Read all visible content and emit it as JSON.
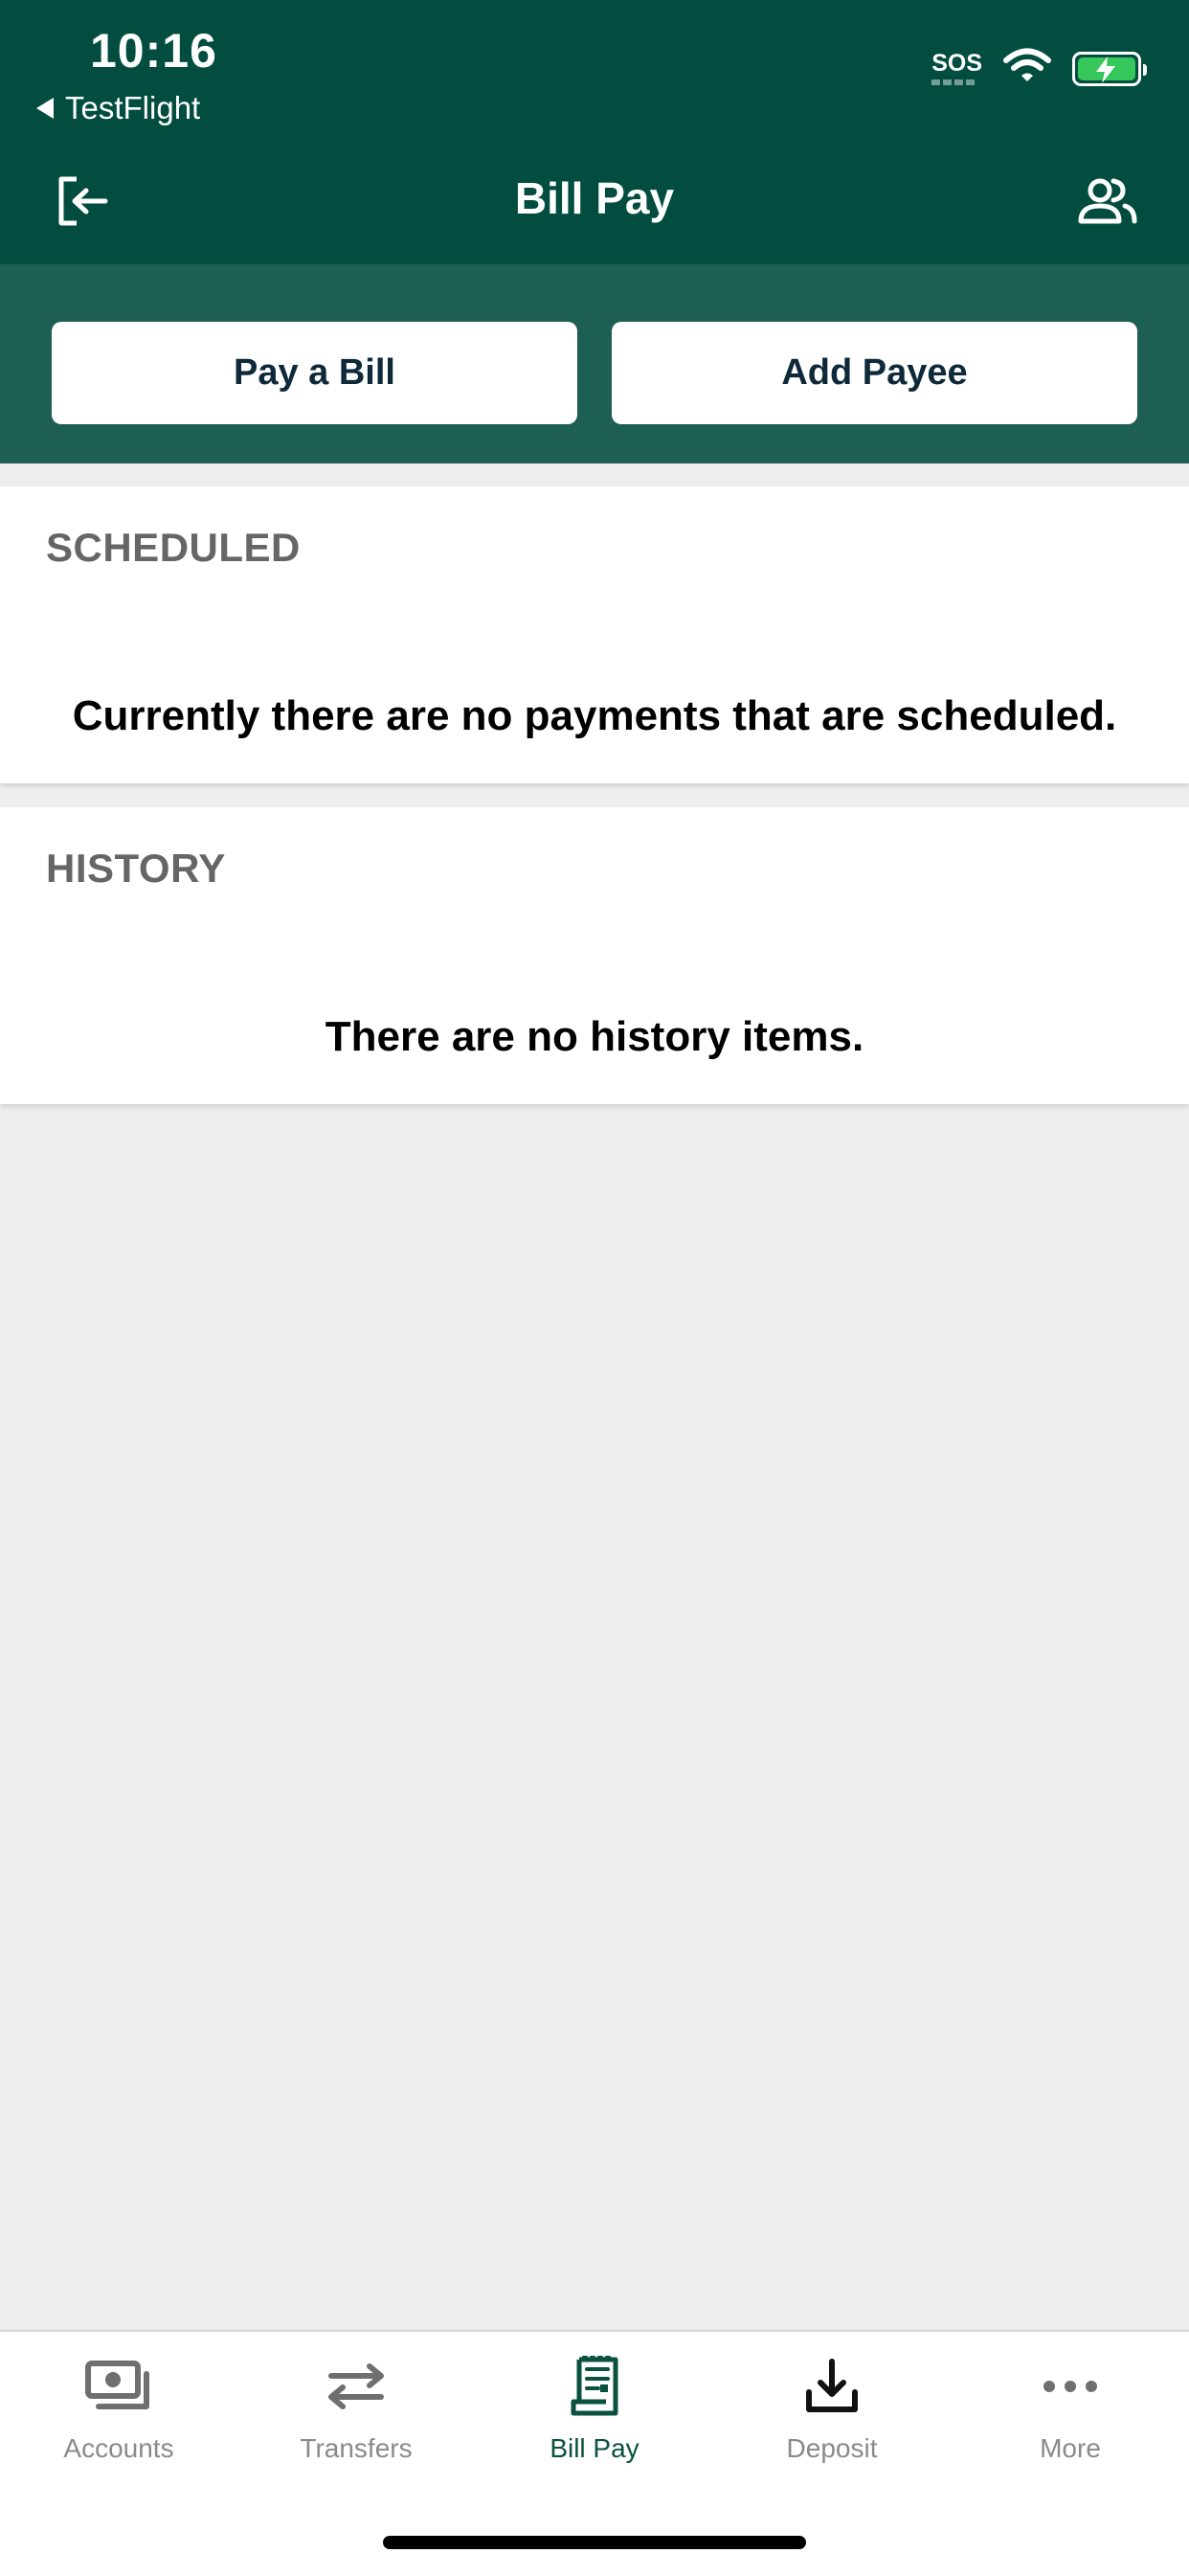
{
  "status_bar": {
    "time": "10:16",
    "back_app": "TestFlight",
    "sos": "SOS",
    "icons": [
      "wifi-icon",
      "battery-charging-icon"
    ]
  },
  "header": {
    "title": "Bill Pay",
    "left_icon": "logout-icon",
    "right_icon": "profile-icon"
  },
  "actions": {
    "pay_bill": "Pay a Bill",
    "add_payee": "Add Payee"
  },
  "scheduled": {
    "heading": "SCHEDULED",
    "empty_message": "Currently there are no payments that are scheduled."
  },
  "history": {
    "heading": "HISTORY",
    "empty_message": "There are no history items."
  },
  "tabs": [
    {
      "label": "Accounts",
      "icon": "accounts-icon",
      "active": false
    },
    {
      "label": "Transfers",
      "icon": "transfers-icon",
      "active": false
    },
    {
      "label": "Bill Pay",
      "icon": "bill-pay-icon",
      "active": true
    },
    {
      "label": "Deposit",
      "icon": "deposit-icon",
      "active": false
    },
    {
      "label": "More",
      "icon": "more-icon",
      "active": false
    }
  ],
  "colors": {
    "header_bg": "#024d40",
    "action_bar_bg": "#1d5f52",
    "active_tab": "#0a5140",
    "inactive_tab": "#8a8a8a",
    "button_text": "#0e2a3a",
    "page_bg": "#eeeeee"
  }
}
